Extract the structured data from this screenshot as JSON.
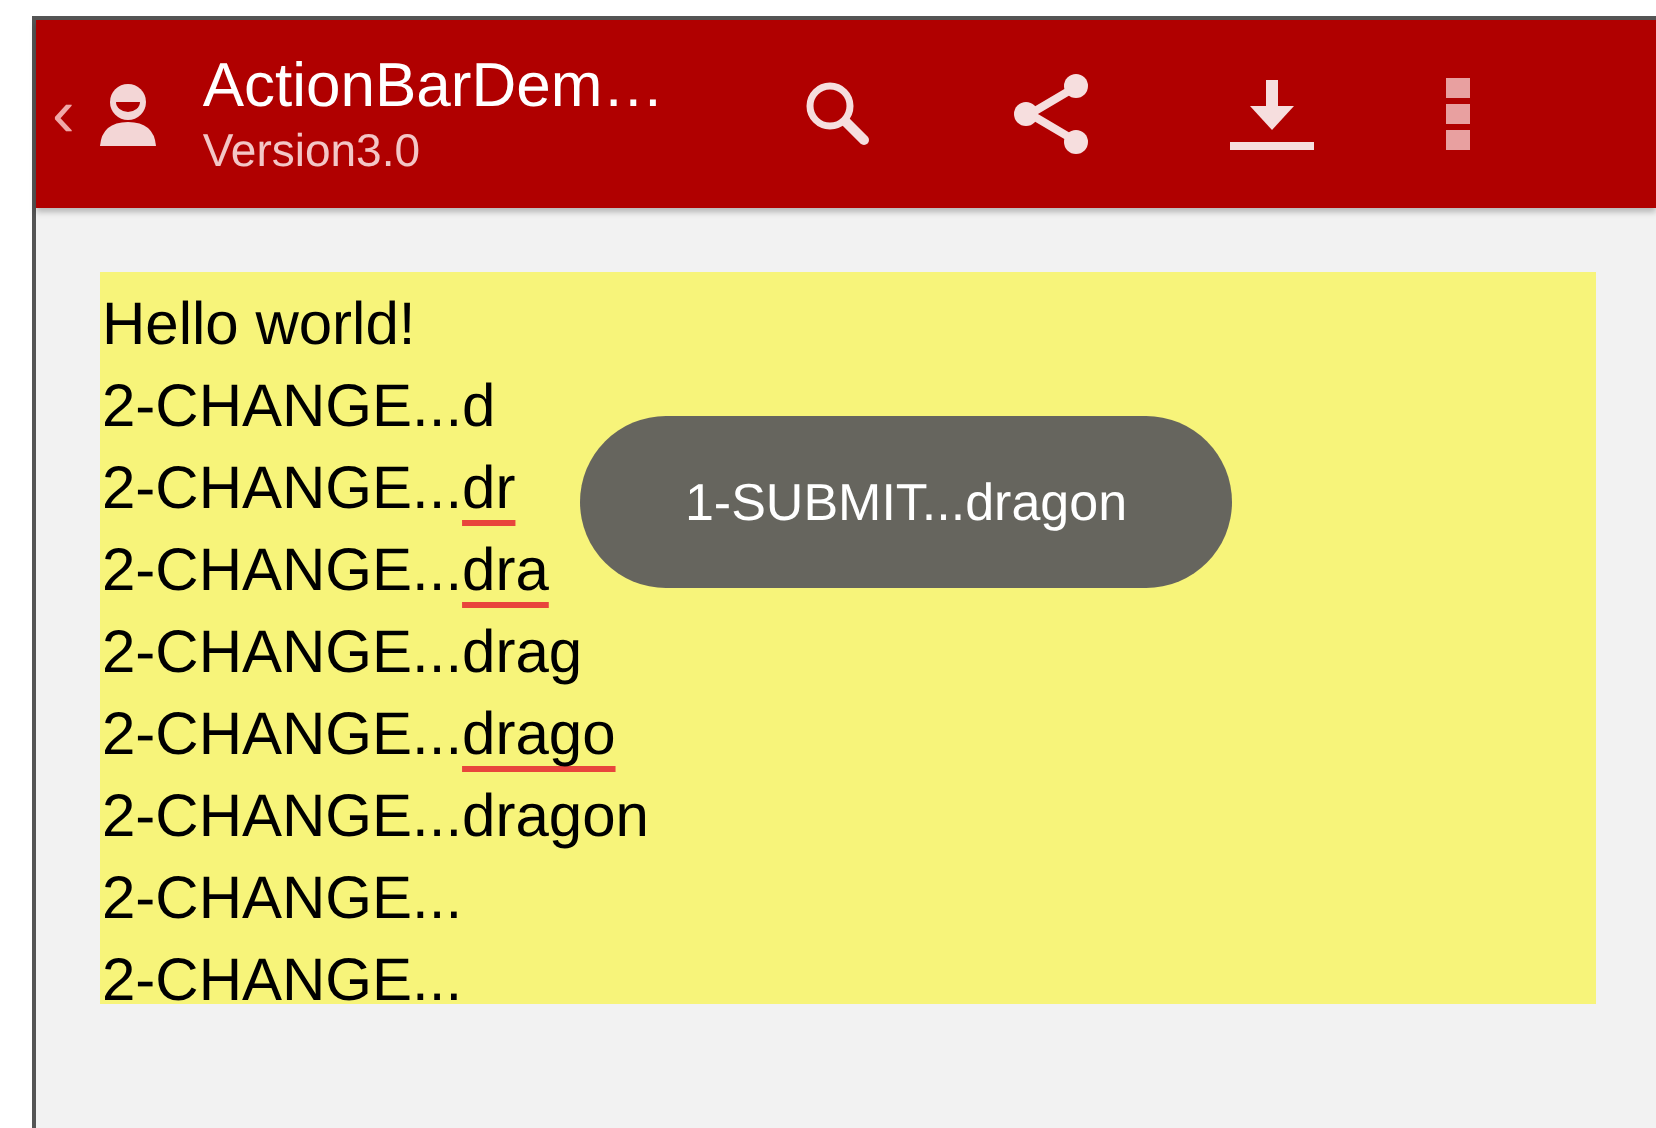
{
  "action_bar": {
    "back": "‹",
    "title": "ActionBarDem…",
    "subtitle": "Version3.0"
  },
  "lines": [
    {
      "text": "Hello world!"
    },
    {
      "text": "2-CHANGE...",
      "word": "d",
      "underlined": false
    },
    {
      "text": "2-CHANGE...",
      "word": "dr",
      "underlined": true
    },
    {
      "text": "2-CHANGE...",
      "word": "dra",
      "underlined": true
    },
    {
      "text": "2-CHANGE...",
      "word": "drag",
      "underlined": false
    },
    {
      "text": "2-CHANGE...",
      "word": "drago",
      "underlined": true
    },
    {
      "text": "2-CHANGE...",
      "word": "dragon",
      "underlined": false
    },
    {
      "text": "2-CHANGE..."
    },
    {
      "text": "2-CHANGE..."
    }
  ],
  "toast": "1-SUBMIT...dragon"
}
